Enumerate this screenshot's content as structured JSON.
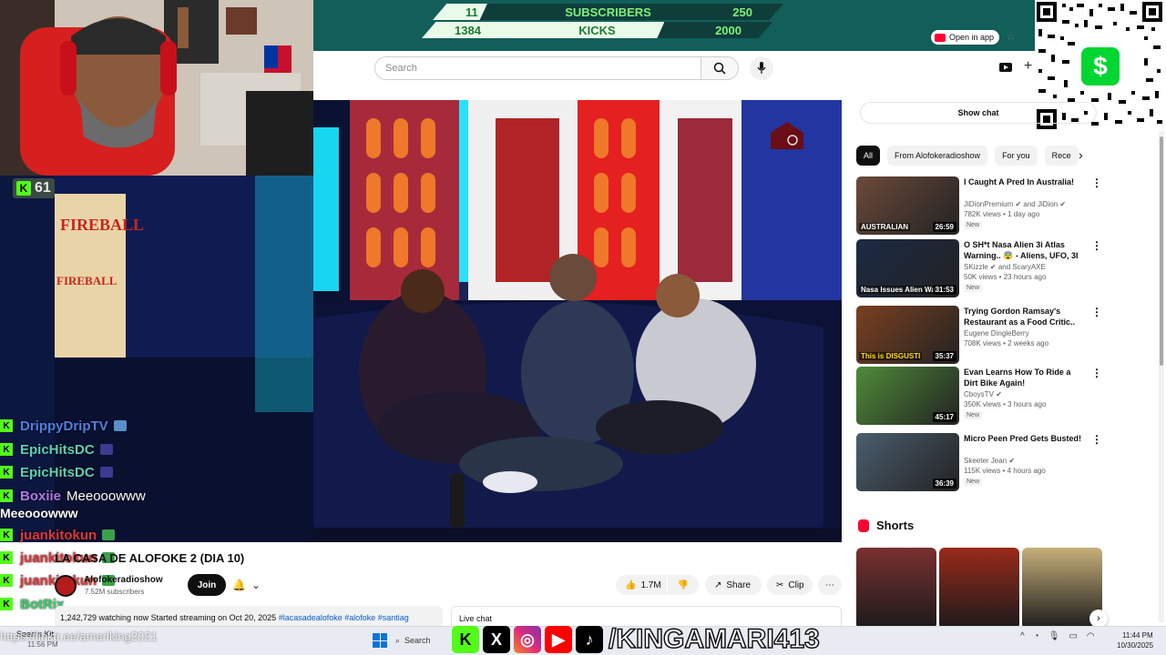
{
  "goals": {
    "row1": {
      "current": "11",
      "label": "SUBSCRIBERS",
      "target": "250",
      "progress": 0.044
    },
    "row2": {
      "current": "1384",
      "label": "KICKS",
      "target": "2000",
      "progress": 0.692
    }
  },
  "kick_viewers": "61",
  "header": {
    "open_in_app": "Open in app",
    "search_placeholder": "Search",
    "show_chat": "Show chat"
  },
  "chat": [
    {
      "user": "DrippyDripTV",
      "color": "#4f7fe0",
      "text": "",
      "emote": "#5a8fc9"
    },
    {
      "user": "EpicHitsDC",
      "color": "#5ed0b0",
      "text": "",
      "emote": "#3b3b8f"
    },
    {
      "user": "EpicHitsDC",
      "color": "#5ed0b0",
      "text": "",
      "emote": "#3b3b8f"
    },
    {
      "user": "Boxiie",
      "color": "#b07ae0",
      "text": "Meeooowww",
      "emote": ""
    },
    {
      "user": "juankitokun",
      "color": "#e0373b",
      "text": "",
      "emote": "#3aa04a"
    },
    {
      "user": "juankitokun",
      "color": "#e0373b",
      "text": "",
      "emote": "#3aa04a"
    },
    {
      "user": "juankitokun",
      "color": "#e0373b",
      "text": "",
      "emote": "#3aa04a"
    },
    {
      "user": "BotRix",
      "color": "#3ad06a",
      "text": "",
      "emote": ""
    }
  ],
  "chat_wrap": "Meeooowww",
  "video": {
    "title": "LA CASA DE ALOFOKE 2 (DIA 10)",
    "channel": "Alofokeradioshow",
    "subscribers": "7.52M subscribers",
    "join": "Join",
    "likes": "1.7M",
    "share": "Share",
    "clip": "Clip",
    "watching": "1,242,729 watching now",
    "started": "Started streaming on Oct 20, 2025",
    "tags": "#lacasadealofoke #alofoke #santiag",
    "live_chat": "Live chat"
  },
  "chips": [
    "All",
    "From Alofokeradioshow",
    "For you",
    "Rece"
  ],
  "recommendations": [
    {
      "title": "I Caught A Pred In Australia!",
      "channel": "JiDionPremium ✔ and JiDion ✔",
      "meta": "782K views • 1 day ago",
      "badge": "New",
      "duration": "26:59",
      "thumb_color": "#6b4a3a"
    },
    {
      "title": "O SH*t Nasa Alien 3i Atlas Warning.. 😨 - Aliens, UFO, 3I ...",
      "channel": "SKizzle ✔ and ScaryAXE",
      "meta": "50K views • 23 hours ago",
      "badge": "New",
      "duration": "31:53",
      "thumb_color": "#1b2a44"
    },
    {
      "title": "Trying Gordon Ramsay's Restaurant as a Food Critic..",
      "channel": "Eugene DingleBerry",
      "meta": "708K views • 2 weeks ago",
      "badge": "",
      "duration": "35:37",
      "thumb_color": "#7a4020"
    },
    {
      "title": "Evan Learns How To Ride a Dirt Bike Again!",
      "channel": "CboysTV ✔",
      "meta": "350K views • 3 hours ago",
      "badge": "New",
      "duration": "45:17",
      "thumb_color": "#4f8b3a"
    },
    {
      "title": "Micro Peen Pred Gets Busted!",
      "channel": "Skeeter Jean ✔",
      "meta": "115K views • 4 hours ago",
      "badge": "New",
      "duration": "36:39",
      "thumb_color": "#4a5e6e"
    }
  ],
  "thumb_text": {
    "australian": "AUSTRALIAN",
    "nasa": "Nasa Issues Alien Warr",
    "disgusting": "This is DISGUSTI"
  },
  "shorts_label": "Shorts",
  "shorts_colors": [
    "#7a3030",
    "#9a2a1a",
    "#c7b07a"
  ],
  "taskbar": {
    "weather": "Seems Kit",
    "weather_sub": "11:56 PM",
    "url_overlay": "https://linktr.ee/ameriking2021",
    "search": "Search",
    "social_handle": "/KINGAMARI413",
    "time": "11:44 PM",
    "date": "10/30/2025"
  },
  "icons": {
    "x": "X",
    "tiktok": "♪",
    "cashapp": "$"
  }
}
